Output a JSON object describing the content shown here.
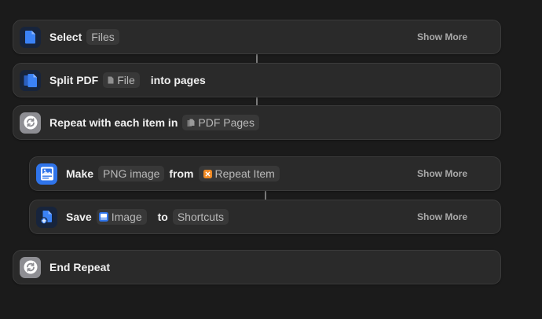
{
  "actions": [
    {
      "word1": "Select",
      "token": "Files",
      "show_more": "Show More"
    },
    {
      "word1": "Split PDF",
      "token": "File",
      "word2": "into pages"
    },
    {
      "word1": "Repeat with each item in",
      "token": "PDF Pages"
    },
    {
      "word1": "Make",
      "token1": "PNG image",
      "word2": "from",
      "token2": "Repeat Item",
      "show_more": "Show More"
    },
    {
      "word1": "Save",
      "token1": "Image",
      "word2": "to",
      "token2": "Shortcuts",
      "show_more": "Show More"
    },
    {
      "word1": "End Repeat"
    }
  ],
  "icons": {
    "select": "document-icon",
    "split": "documents-icon",
    "repeat": "repeat-icon",
    "make": "image-icon",
    "save": "save-file-icon",
    "end_repeat": "repeat-icon"
  },
  "colors": {
    "background": "#1b1b1b",
    "card": "#2a2a2a",
    "accent_blue": "#2f74ea",
    "repeat_gray": "#8e8e93",
    "variable_orange": "#f08a24"
  }
}
